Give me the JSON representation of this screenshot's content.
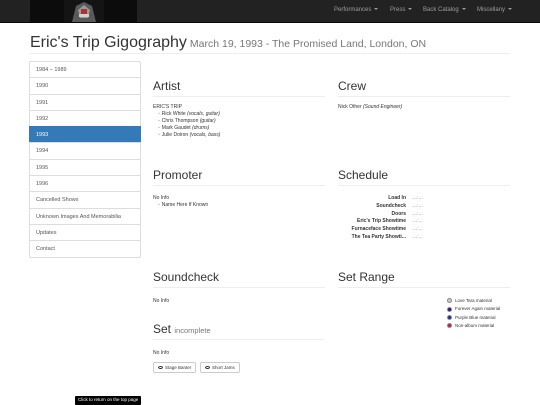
{
  "nav": {
    "items": [
      {
        "label": "Performances"
      },
      {
        "label": "Press"
      },
      {
        "label": "Back Catalog"
      },
      {
        "label": "Miscellany"
      }
    ]
  },
  "header": {
    "title": "Eric's Trip Gigography",
    "subtitle": "March 19, 1993 - The Promised Land, London, ON"
  },
  "sidebar": {
    "items": [
      {
        "label": "1984 – 1989"
      },
      {
        "label": "1990"
      },
      {
        "label": "1991"
      },
      {
        "label": "1992"
      },
      {
        "label": "1993",
        "active": true
      },
      {
        "label": "1994"
      },
      {
        "label": "1995"
      },
      {
        "label": "1996"
      },
      {
        "label": "Cancelled Shows"
      },
      {
        "label": "Unknown Images And Memorabilia"
      },
      {
        "label": "Updates"
      },
      {
        "label": "Contact"
      }
    ]
  },
  "artist": {
    "heading": "Artist",
    "band": "ERIC'S TRIP",
    "members": [
      {
        "name": "Rick White",
        "role": "(vocals, guitar)"
      },
      {
        "name": "Chris Thompson",
        "role": "(guitar)"
      },
      {
        "name": "Mark Gaudet",
        "role": "(drums)"
      },
      {
        "name": "Julie Doiron",
        "role": "(vocals, bass)"
      }
    ]
  },
  "crew": {
    "heading": "Crew",
    "name": "Nick Other",
    "role": "(Sound Engineer)"
  },
  "promoter": {
    "heading": "Promoter",
    "info": "No Info",
    "item": "Name Here If Known"
  },
  "schedule": {
    "heading": "Schedule",
    "rows": [
      {
        "label": "Load In",
        "value": "...:..."
      },
      {
        "label": "Soundcheck",
        "value": "...:..."
      },
      {
        "label": "Doors",
        "value": "...:..."
      },
      {
        "label": "Eric's Trip Showtime",
        "value": "...:..."
      },
      {
        "label": "Furnaceface Showtime",
        "value": "...:..."
      },
      {
        "label": "The Tea Party Showti...",
        "value": "...:..."
      }
    ]
  },
  "soundcheck": {
    "heading": "Soundcheck",
    "info": "No Info"
  },
  "set": {
    "heading": "Set",
    "status": "incomplete",
    "info": "No Info",
    "buttons": [
      {
        "label": "Stage Banter"
      },
      {
        "label": "Short Jams"
      }
    ]
  },
  "set_range": {
    "heading": "Set Range",
    "legend": [
      {
        "label": "Love Tara material",
        "color": "#c8c8c8"
      },
      {
        "label": "Forever Again material",
        "color": "#3a0a8c"
      },
      {
        "label": "Purple Blue material",
        "color": "#1a2aa8"
      },
      {
        "label": "Non-album material",
        "color": "#c41e3a"
      }
    ]
  },
  "footer": {
    "to_top": "Click to return on the top page"
  }
}
